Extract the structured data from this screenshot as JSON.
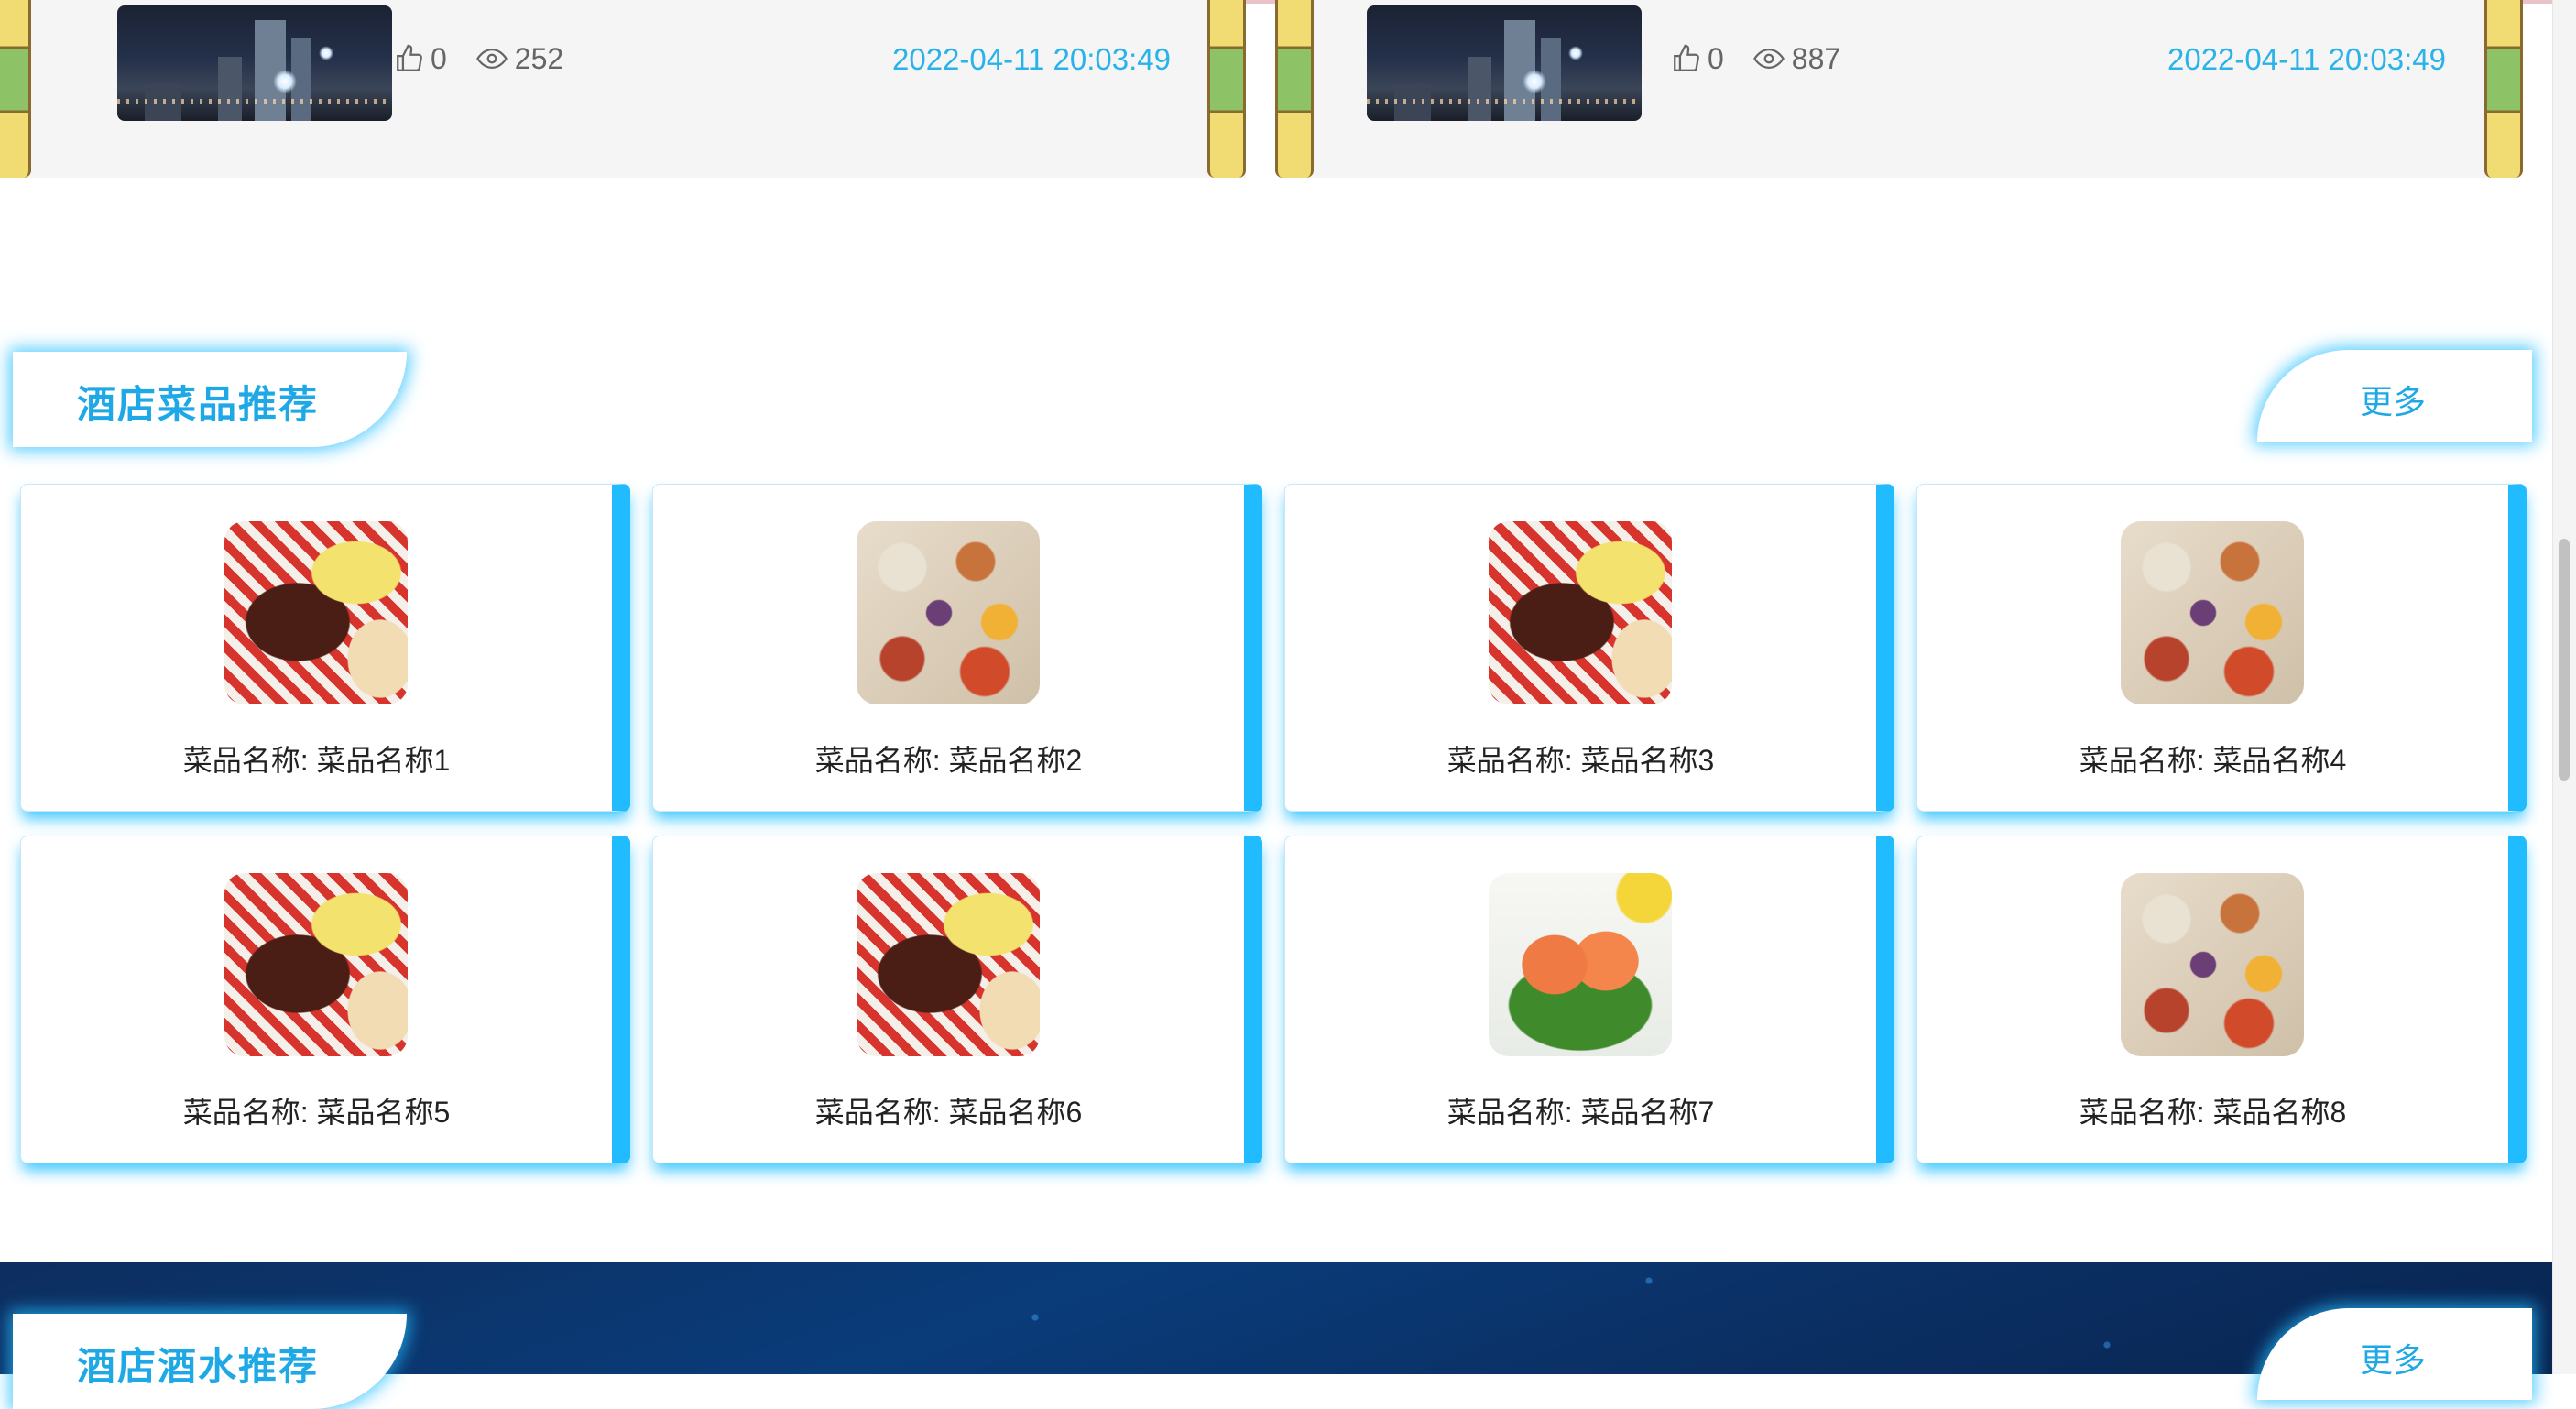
{
  "news_cards": [
    {
      "likes": "0",
      "views": "252",
      "date": "2022-04-11 20:03:49"
    },
    {
      "likes": "0",
      "views": "887",
      "date": "2022-04-11 20:03:49"
    }
  ],
  "dish_section": {
    "title": "酒店菜品推荐",
    "more": "更多",
    "items": [
      {
        "name": "菜品名称: 菜品名称1",
        "image": "bbq-meat-platter"
      },
      {
        "name": "菜品名称: 菜品名称2",
        "image": "table-spread-dishes"
      },
      {
        "name": "菜品名称: 菜品名称3",
        "image": "bbq-meat-platter"
      },
      {
        "name": "菜品名称: 菜品名称4",
        "image": "table-spread-dishes"
      },
      {
        "name": "菜品名称: 菜品名称5",
        "image": "bbq-meat-platter"
      },
      {
        "name": "菜品名称: 菜品名称6",
        "image": "bbq-meat-platter"
      },
      {
        "name": "菜品名称: 菜品名称7",
        "image": "salmon-salad"
      },
      {
        "name": "菜品名称: 菜品名称8",
        "image": "table-spread-dishes"
      }
    ]
  },
  "drink_section": {
    "title": "酒店酒水推荐",
    "more": "更多"
  },
  "colors": {
    "accent": "#1ea9e6",
    "card_glow": "#21bbff",
    "dark_section": "#0a3c7a"
  }
}
